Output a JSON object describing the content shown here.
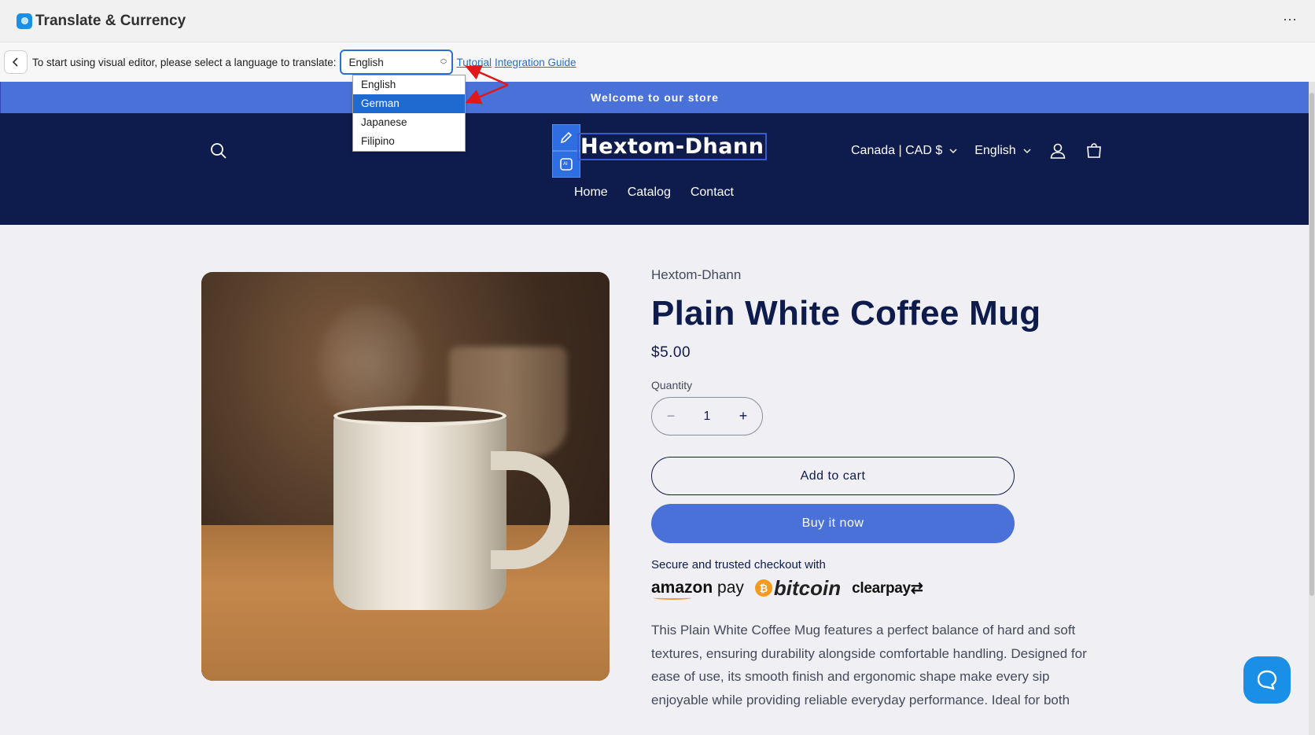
{
  "app": {
    "title": "Translate & Currency",
    "more_label": "⋯",
    "icons": {
      "app_logo": "globe-icon",
      "more": "more-horizontal-icon"
    }
  },
  "editor_bar": {
    "prompt": "To start using visual editor, please select a language to translate:",
    "language_select": {
      "value": "English",
      "options": [
        "English",
        "German",
        "Japanese",
        "Filipino"
      ],
      "highlighted": "German"
    },
    "links": {
      "tutorial": "Tutorial",
      "integration_guide": "Integration Guide"
    },
    "annotation_color": "#e0171b"
  },
  "store": {
    "announcement": "Welcome to our store",
    "brand": "Hextom-Dhann",
    "location_selector": "Canada | CAD $",
    "language_selector": "English",
    "nav": [
      "Home",
      "Catalog",
      "Contact"
    ],
    "product": {
      "vendor": "Hextom-Dhann",
      "title": "Plain White Coffee Mug",
      "price": "$5.00",
      "quantity_label": "Quantity",
      "quantity_value": "1",
      "minus": "−",
      "plus": "+",
      "add_to_cart": "Add to cart",
      "buy_now": "Buy it now",
      "secure_checkout": "Secure and trusted checkout with",
      "payment_methods": {
        "amazon": "amazon",
        "amazon_pay": " pay",
        "bitcoin": "bitcoin",
        "bitcoin_symbol": "₿",
        "clearpay": "clearpay⇄"
      },
      "description": "This Plain White Coffee Mug features a perfect balance of hard and soft textures, ensuring durability alongside comfortable handling. Designed for ease of use, its smooth finish and ergonomic shape make every sip enjoyable while providing reliable everyday performance. Ideal for both"
    },
    "colors": {
      "announcement_bg": "#4a71d8",
      "header_bg": "#0e1b4d",
      "primary_button": "#4a71d8",
      "chat_button": "#1a8fe8"
    }
  }
}
